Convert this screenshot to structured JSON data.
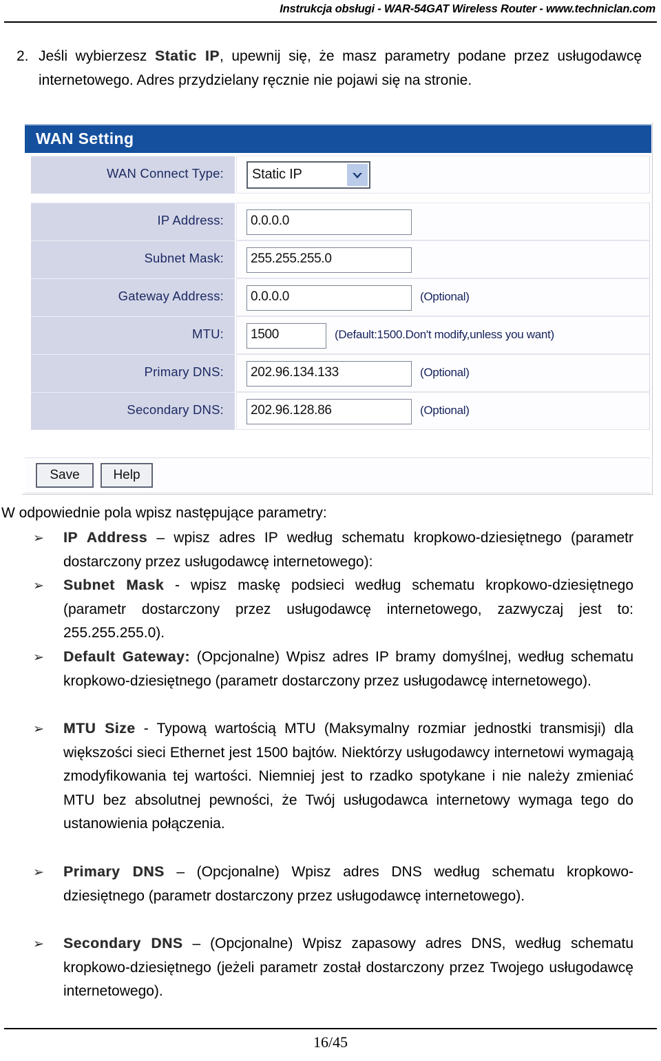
{
  "header": {
    "running_head": "Instrukcja obsługi -  WAR-54GAT Wireless Router - www.techniclan.com"
  },
  "intro": {
    "number": "2.",
    "text_before": "Jeśli wybierzesz ",
    "keyword": "Static IP",
    "text_after": ", upewnij się, że masz parametry podane przez usługodawcę internetowego. Adres przydzielany ręcznie nie pojawi się na stronie."
  },
  "router_ui": {
    "panel_title": "WAN Setting",
    "accent_color": "#15509e",
    "label_cell_color": "#d2d6e6",
    "connect_type": {
      "label": "WAN Connect Type:",
      "selected": "Static IP",
      "dropdown_icon": "chevron-down-icon"
    },
    "fields": [
      {
        "label": "IP Address:",
        "value": "0.0.0.0",
        "hint": "",
        "narrow": false
      },
      {
        "label": "Subnet Mask:",
        "value": "255.255.255.0",
        "hint": "",
        "narrow": false
      },
      {
        "label": "Gateway Address:",
        "value": "0.0.0.0",
        "hint": "(Optional)",
        "narrow": false
      },
      {
        "label": "MTU:",
        "value": "1500",
        "hint": "(Default:1500.Don't modify,unless you want)",
        "narrow": true
      },
      {
        "label": "Primary DNS:",
        "value": "202.96.134.133",
        "hint": "(Optional)",
        "narrow": false
      },
      {
        "label": "Secondary DNS:",
        "value": "202.96.128.86",
        "hint": "(Optional)",
        "narrow": false
      }
    ],
    "buttons": {
      "save": "Save",
      "help": "Help"
    }
  },
  "body": {
    "lead_line": "W odpowiednie pola wpisz następujące parametry:",
    "bullet_glyph": "➢",
    "bullets": [
      {
        "keyword": "IP Address",
        "rest": " – wpisz adres IP według schematu kropkowo-dziesiętnego (parametr dostarczony przez usługodawcę internetowego):"
      },
      {
        "keyword": "Subnet Mask",
        "rest": " - wpisz maskę podsieci według schematu kropkowo-dziesiętnego (parametr dostarczony przez usługodawcę internetowego, zazwyczaj jest to: 255.255.255.0)."
      },
      {
        "keyword": "Default Gateway:",
        "rest": " (Opcjonalne) Wpisz adres IP bramy domyślnej, według schematu kropkowo-dziesiętnego (parametr dostarczony przez usługodawcę internetowego)."
      },
      {
        "keyword": "MTU Size",
        "rest": " - Typową wartością MTU (Maksymalny rozmiar jednostki transmisji) dla większości sieci Ethernet jest 1500 bajtów. Niektórzy usługodawcy internetowi wymagają zmodyfikowania tej wartości. Niemniej jest to rzadko spotykane i nie należy zmieniać MTU bez absolutnej pewności, że Twój usługodawca internetowy wymaga tego do ustanowienia połączenia."
      },
      {
        "keyword": "Primary DNS",
        "rest": " – (Opcjonalne) Wpisz adres DNS według schematu kropkowo-dziesiętnego (parametr dostarczony przez usługodawcę internetowego)."
      },
      {
        "keyword": "Secondary DNS",
        "rest": " – (Opcjonalne) Wpisz zapasowy adres DNS, według schematu kropkowo-dziesiętnego (jeżeli parametr został dostarczony przez Twojego usługodawcę internetowego)."
      }
    ]
  },
  "footer": {
    "page_number": "16/45"
  }
}
